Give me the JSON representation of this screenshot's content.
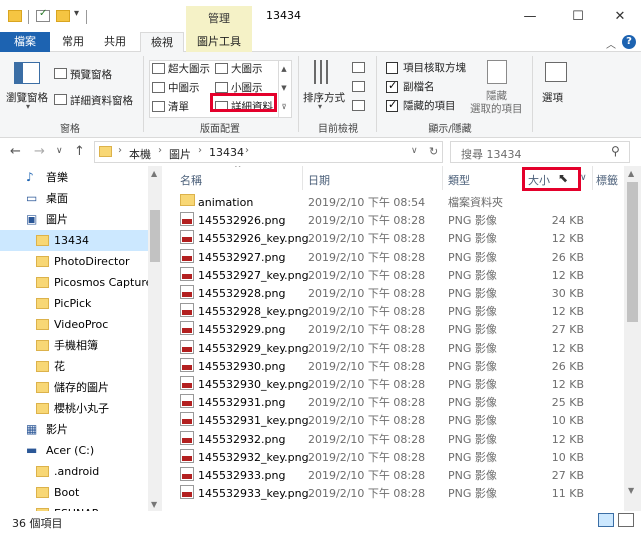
{
  "titlebar": {
    "manage_tab": "管理",
    "title": "13434",
    "minimize": "—",
    "maximize": "☐",
    "close": "✕"
  },
  "ribbon_tabs": [
    "檔案",
    "常用",
    "共用",
    "檢視",
    "圖片工具"
  ],
  "ribbon": {
    "panes": {
      "navigation_pane": "瀏覽窗格",
      "preview_pane": "預覽窗格",
      "details_pane": "詳細資料窗格",
      "group_label": "窗格"
    },
    "layout": {
      "extra_large": "超大圖示",
      "large": "大圖示",
      "medium": "中圖示",
      "small": "小圖示",
      "list": "清單",
      "details": "詳細資料",
      "group_label": "版面配置"
    },
    "current_view": {
      "sort_by": "排序方式",
      "group_label": "目前檢視"
    },
    "show_hide": {
      "item_checkboxes": "項目核取方塊",
      "file_extensions": "副檔名",
      "hidden_items": "隱藏的項目",
      "hide_selected_line1": "隱藏",
      "hide_selected_line2": "選取的項目",
      "group_label": "顯示/隱藏",
      "checked": {
        "item_checkboxes": false,
        "file_extensions": true,
        "hidden_items": true
      }
    },
    "options": "選項"
  },
  "address": {
    "crumbs": [
      "本機",
      "圖片",
      "13434"
    ],
    "search_placeholder": "搜尋 13434"
  },
  "nav_items": [
    {
      "label": "音樂",
      "icon": "music-icon",
      "indent": 1
    },
    {
      "label": "桌面",
      "icon": "desktop-icon",
      "indent": 1
    },
    {
      "label": "圖片",
      "icon": "pictures-icon",
      "indent": 1
    },
    {
      "label": "13434",
      "icon": "folder-icon",
      "indent": 2,
      "selected": true
    },
    {
      "label": "PhotoDirector",
      "icon": "folder-icon",
      "indent": 2
    },
    {
      "label": "Picosmos Capture",
      "icon": "folder-icon",
      "indent": 2
    },
    {
      "label": "PicPick",
      "icon": "folder-icon",
      "indent": 2
    },
    {
      "label": "VideoProc",
      "icon": "folder-icon",
      "indent": 2
    },
    {
      "label": "手機相簿",
      "icon": "folder-icon",
      "indent": 2
    },
    {
      "label": "花",
      "icon": "folder-icon",
      "indent": 2
    },
    {
      "label": "儲存的圖片",
      "icon": "folder-icon",
      "indent": 2
    },
    {
      "label": "櫻桃小丸子",
      "icon": "folder-icon",
      "indent": 2
    },
    {
      "label": "影片",
      "icon": "video-icon",
      "indent": 1
    },
    {
      "label": "Acer (C:)",
      "icon": "drive-icon",
      "indent": 1
    },
    {
      "label": ".android",
      "icon": "folder-icon",
      "indent": 2
    },
    {
      "label": "Boot",
      "icon": "folder-icon",
      "indent": 2
    },
    {
      "label": "ESUNAP",
      "icon": "folder-icon",
      "indent": 2
    }
  ],
  "columns": {
    "name": "名稱",
    "date": "日期",
    "type": "類型",
    "size": "大小",
    "tags": "標籤"
  },
  "files": [
    {
      "name": "animation",
      "date": "2019/2/10 下午 08:54",
      "type": "檔案資料夾",
      "size": "",
      "kind": "folder"
    },
    {
      "name": "145532926.png",
      "date": "2019/2/10 下午 08:28",
      "type": "PNG 影像",
      "size": "24 KB",
      "kind": "png"
    },
    {
      "name": "145532926_key.png",
      "date": "2019/2/10 下午 08:28",
      "type": "PNG 影像",
      "size": "12 KB",
      "kind": "png"
    },
    {
      "name": "145532927.png",
      "date": "2019/2/10 下午 08:28",
      "type": "PNG 影像",
      "size": "26 KB",
      "kind": "png"
    },
    {
      "name": "145532927_key.png",
      "date": "2019/2/10 下午 08:28",
      "type": "PNG 影像",
      "size": "12 KB",
      "kind": "png"
    },
    {
      "name": "145532928.png",
      "date": "2019/2/10 下午 08:28",
      "type": "PNG 影像",
      "size": "30 KB",
      "kind": "png"
    },
    {
      "name": "145532928_key.png",
      "date": "2019/2/10 下午 08:28",
      "type": "PNG 影像",
      "size": "12 KB",
      "kind": "png"
    },
    {
      "name": "145532929.png",
      "date": "2019/2/10 下午 08:28",
      "type": "PNG 影像",
      "size": "27 KB",
      "kind": "png"
    },
    {
      "name": "145532929_key.png",
      "date": "2019/2/10 下午 08:28",
      "type": "PNG 影像",
      "size": "12 KB",
      "kind": "png"
    },
    {
      "name": "145532930.png",
      "date": "2019/2/10 下午 08:28",
      "type": "PNG 影像",
      "size": "26 KB",
      "kind": "png"
    },
    {
      "name": "145532930_key.png",
      "date": "2019/2/10 下午 08:28",
      "type": "PNG 影像",
      "size": "12 KB",
      "kind": "png"
    },
    {
      "name": "145532931.png",
      "date": "2019/2/10 下午 08:28",
      "type": "PNG 影像",
      "size": "25 KB",
      "kind": "png"
    },
    {
      "name": "145532931_key.png",
      "date": "2019/2/10 下午 08:28",
      "type": "PNG 影像",
      "size": "10 KB",
      "kind": "png"
    },
    {
      "name": "145532932.png",
      "date": "2019/2/10 下午 08:28",
      "type": "PNG 影像",
      "size": "12 KB",
      "kind": "png"
    },
    {
      "name": "145532932_key.png",
      "date": "2019/2/10 下午 08:28",
      "type": "PNG 影像",
      "size": "10 KB",
      "kind": "png"
    },
    {
      "name": "145532933.png",
      "date": "2019/2/10 下午 08:28",
      "type": "PNG 影像",
      "size": "27 KB",
      "kind": "png"
    },
    {
      "name": "145532933_key.png",
      "date": "2019/2/10 下午 08:28",
      "type": "PNG 影像",
      "size": "11 KB",
      "kind": "png"
    }
  ],
  "status": {
    "item_count": "36 個項目"
  },
  "colors": {
    "accent": "#1d63b1",
    "highlight": "#e4002b",
    "picture_tools": "#f5f2c7",
    "selection": "#cce8ff"
  }
}
